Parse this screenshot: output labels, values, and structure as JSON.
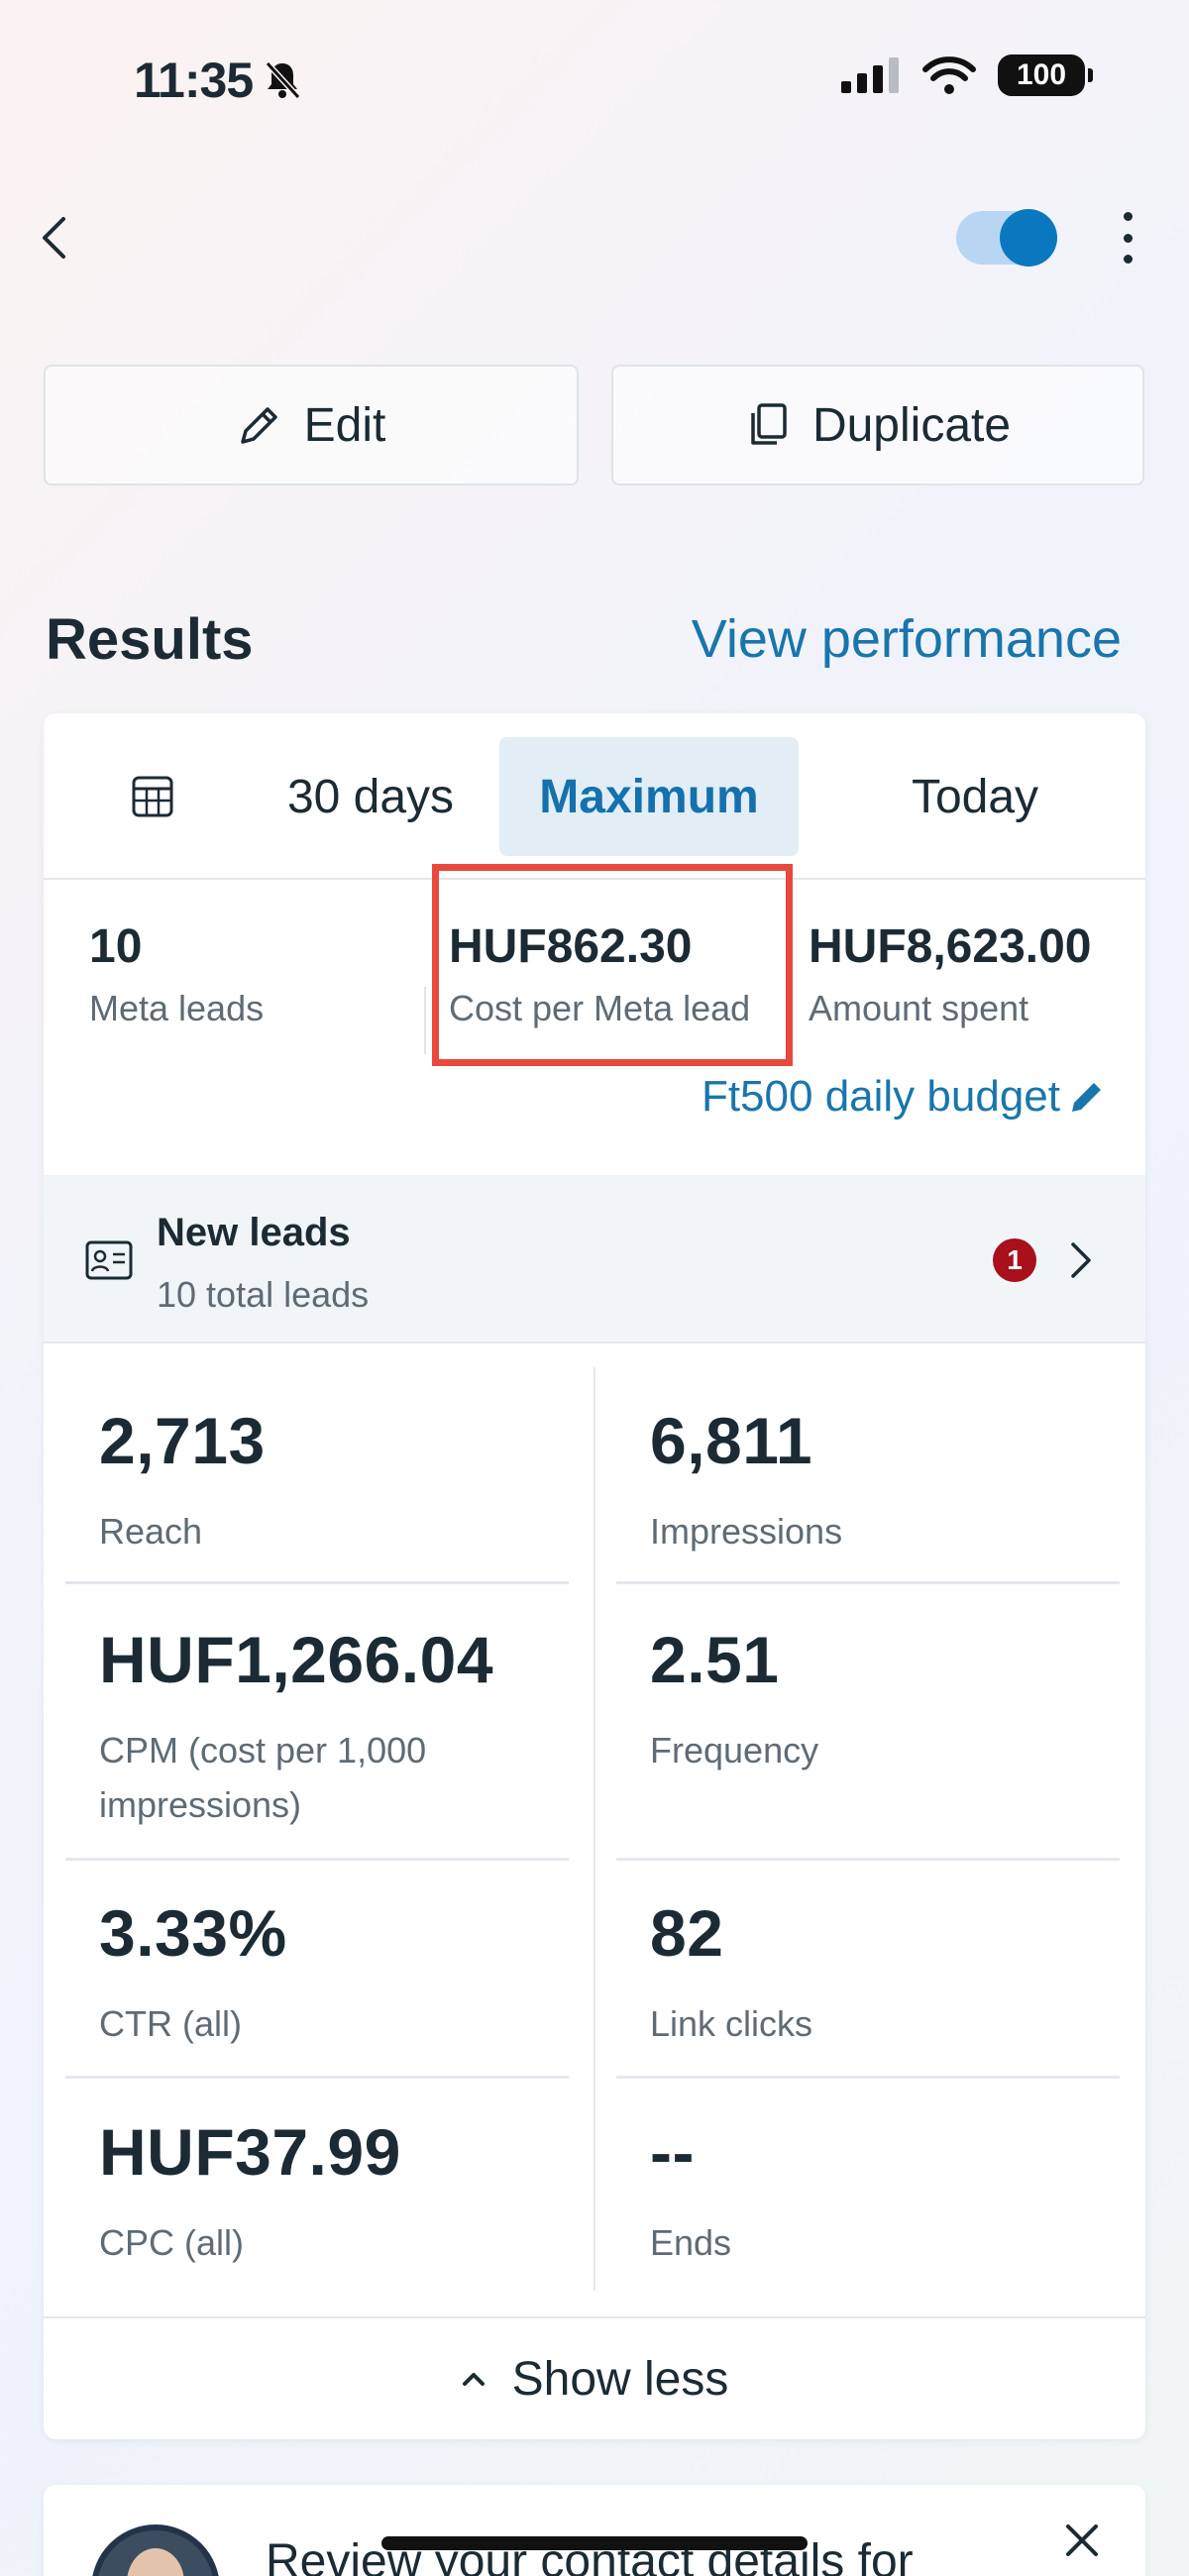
{
  "status_bar": {
    "time": "11:35",
    "battery": "100"
  },
  "actions": {
    "edit_label": "Edit",
    "duplicate_label": "Duplicate"
  },
  "results": {
    "title": "Results",
    "view_performance": "View performance",
    "tabs": [
      {
        "label": "30 days",
        "selected": false
      },
      {
        "label": "Maximum",
        "selected": true
      },
      {
        "label": "Today",
        "selected": false
      }
    ],
    "kpis": [
      {
        "value": "10",
        "label": "Meta leads"
      },
      {
        "value": "HUF862.30",
        "label": "Cost per Meta lead"
      },
      {
        "value": "HUF8,623.00",
        "label": "Amount spent"
      }
    ],
    "budget_link": "Ft500 daily budget",
    "leads": {
      "title": "New leads",
      "subtitle": "10 total leads",
      "badge": "1"
    },
    "metrics": [
      {
        "value": "2,713",
        "label": "Reach"
      },
      {
        "value": "6,811",
        "label": "Impressions"
      },
      {
        "value": "HUF1,266.04",
        "label": "CPM (cost per 1,000 impressions)"
      },
      {
        "value": "2.51",
        "label": "Frequency"
      },
      {
        "value": "3.33%",
        "label": "CTR (all)"
      },
      {
        "value": "82",
        "label": "Link clicks"
      },
      {
        "value": "HUF37.99",
        "label": "CPC (all)"
      },
      {
        "value": "--",
        "label": "Ends"
      }
    ],
    "show_less": "Show less"
  },
  "promo": {
    "text": "Review your contact details for"
  },
  "colors": {
    "accent": "#1876ad",
    "highlight": "#e8493c",
    "badge": "#a8101c"
  }
}
